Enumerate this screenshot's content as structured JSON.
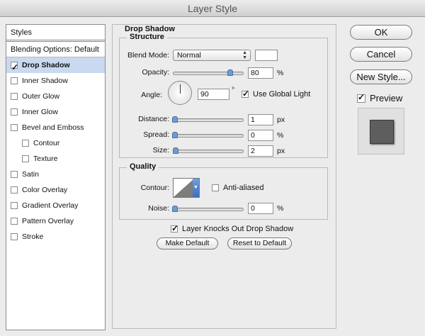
{
  "window": {
    "title": "Layer Style"
  },
  "styles_list": {
    "header": "Styles",
    "blending_options": "Blending Options: Default",
    "items": [
      {
        "label": "Drop Shadow",
        "checked": true,
        "selected": true,
        "indent": false
      },
      {
        "label": "Inner Shadow",
        "checked": false,
        "selected": false,
        "indent": false
      },
      {
        "label": "Outer Glow",
        "checked": false,
        "selected": false,
        "indent": false
      },
      {
        "label": "Inner Glow",
        "checked": false,
        "selected": false,
        "indent": false
      },
      {
        "label": "Bevel and Emboss",
        "checked": false,
        "selected": false,
        "indent": false
      },
      {
        "label": "Contour",
        "checked": false,
        "selected": false,
        "indent": true
      },
      {
        "label": "Texture",
        "checked": false,
        "selected": false,
        "indent": true
      },
      {
        "label": "Satin",
        "checked": false,
        "selected": false,
        "indent": false
      },
      {
        "label": "Color Overlay",
        "checked": false,
        "selected": false,
        "indent": false
      },
      {
        "label": "Gradient Overlay",
        "checked": false,
        "selected": false,
        "indent": false
      },
      {
        "label": "Pattern Overlay",
        "checked": false,
        "selected": false,
        "indent": false
      },
      {
        "label": "Stroke",
        "checked": false,
        "selected": false,
        "indent": false
      }
    ]
  },
  "drop_shadow": {
    "title": "Drop Shadow",
    "structure": {
      "title": "Structure",
      "blend_mode_label": "Blend Mode:",
      "blend_mode_value": "Normal",
      "shadow_color": "#ffffff",
      "opacity_label": "Opacity:",
      "opacity_value": "80",
      "opacity_unit": "%",
      "opacity_level": 0.8,
      "angle_label": "Angle:",
      "angle_value": "90",
      "angle_unit": "°",
      "use_global_light_label": "Use Global Light",
      "use_global_light_checked": true,
      "distance_label": "Distance:",
      "distance_value": "1",
      "distance_unit": "px",
      "spread_label": "Spread:",
      "spread_value": "0",
      "spread_unit": "%",
      "size_label": "Size:",
      "size_value": "2",
      "size_unit": "px"
    },
    "quality": {
      "title": "Quality",
      "contour_label": "Contour:",
      "anti_aliased_label": "Anti-aliased",
      "anti_aliased_checked": false,
      "noise_label": "Noise:",
      "noise_value": "0",
      "noise_unit": "%"
    },
    "knocks_out_label": "Layer Knocks Out Drop Shadow",
    "knocks_out_checked": true,
    "make_default_label": "Make Default",
    "reset_default_label": "Reset to Default"
  },
  "buttons": {
    "ok": "OK",
    "cancel": "Cancel",
    "new_style": "New Style..."
  },
  "preview": {
    "label": "Preview",
    "checked": true
  }
}
